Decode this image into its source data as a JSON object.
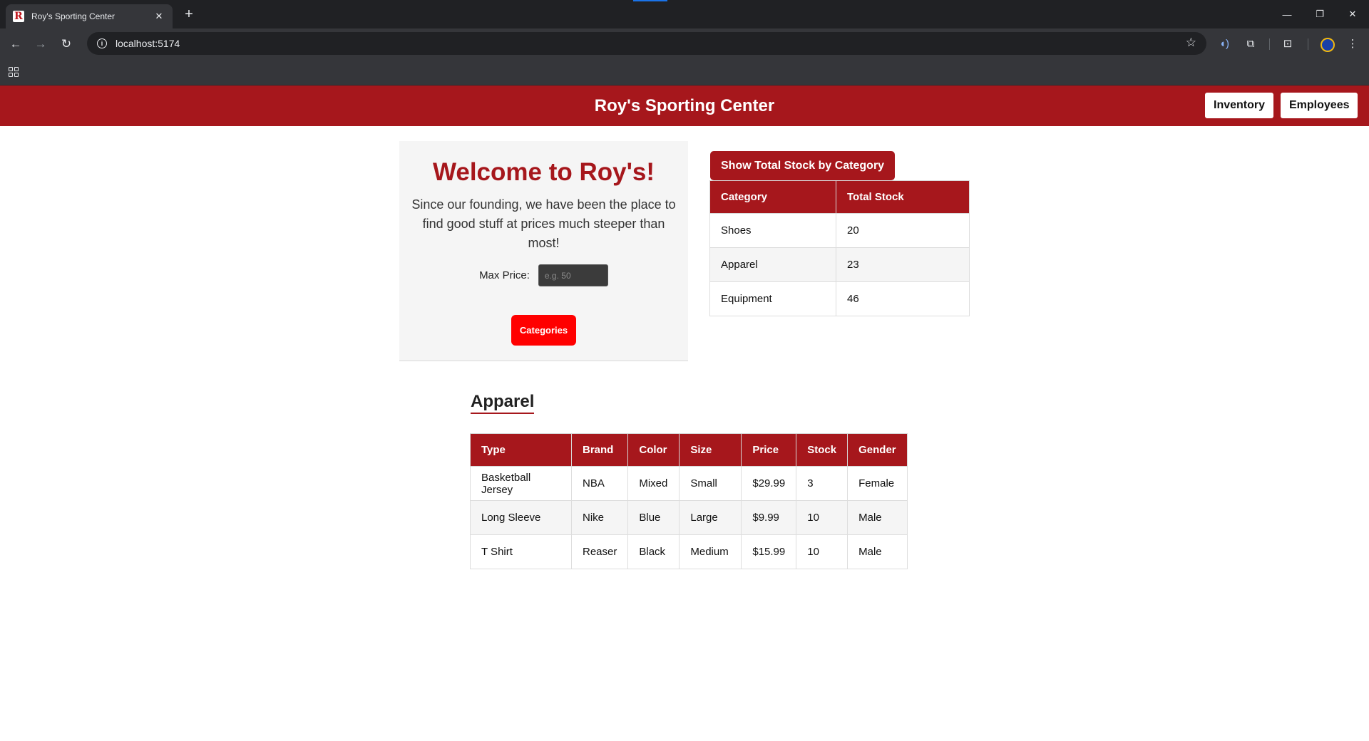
{
  "browser": {
    "tab_title": "Roy's Sporting Center",
    "favicon_letter": "R",
    "url": "localhost:5174"
  },
  "header": {
    "title": "Roy's Sporting Center",
    "inventory_label": "Inventory",
    "employees_label": "Employees"
  },
  "welcome": {
    "title": "Welcome to Roy's!",
    "text": "Since our founding, we have been the place to find good stuff at prices much steeper than most!",
    "max_price_label": "Max Price:",
    "max_price_placeholder": "e.g. 50",
    "categories_label": "Categories"
  },
  "stock": {
    "button_label": "Show Total Stock by Category",
    "headers": [
      "Category",
      "Total Stock"
    ],
    "rows": [
      [
        "Shoes",
        "20"
      ],
      [
        "Apparel",
        "23"
      ],
      [
        "Equipment",
        "46"
      ]
    ]
  },
  "apparel": {
    "heading": "Apparel",
    "headers": [
      "Type",
      "Brand",
      "Color",
      "Size",
      "Price",
      "Stock",
      "Gender"
    ],
    "rows": [
      [
        "Basketball Jersey",
        "NBA",
        "Mixed",
        "Small",
        "$29.99",
        "3",
        "Female"
      ],
      [
        "Long Sleeve",
        "Nike",
        "Blue",
        "Large",
        "$9.99",
        "10",
        "Male"
      ],
      [
        "T Shirt",
        "Reaser",
        "Black",
        "Medium",
        "$15.99",
        "10",
        "Male"
      ]
    ]
  },
  "colors": {
    "brand_red": "#a6171c",
    "button_red": "#ff0000"
  },
  "icons": {
    "toolbar": [
      "back-icon",
      "forward-icon",
      "reload-icon",
      "info-icon",
      "star-icon",
      "read-aloud-icon",
      "extensions-icon",
      "tab-search-icon",
      "profile-icon",
      "menu-icon",
      "apps-icon"
    ]
  }
}
